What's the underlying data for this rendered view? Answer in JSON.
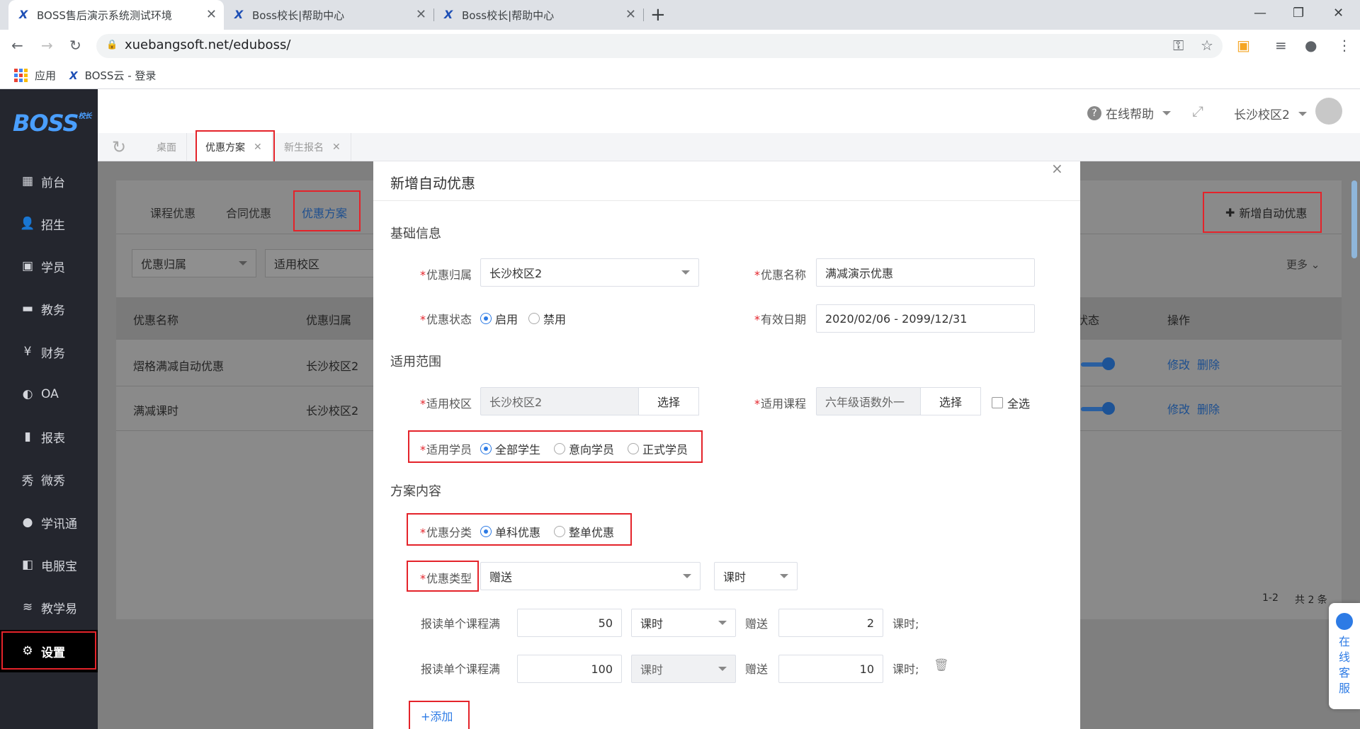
{
  "browser": {
    "tabs": [
      {
        "title": "BOSS售后演示系统测试环境",
        "active": true
      },
      {
        "title": "Boss校长|帮助中心",
        "active": false
      },
      {
        "title": "Boss校长|帮助中心",
        "active": false
      }
    ],
    "url": "xuebangsoft.net/eduboss/",
    "bookmarks": [
      {
        "label": "应用",
        "icon": "apps-grid-icon"
      },
      {
        "label": "BOSS云 - 登录",
        "icon": "boss-favicon"
      }
    ]
  },
  "app": {
    "logo": "BOSS",
    "logo_sub": "校长",
    "menu": [
      {
        "label": "前台",
        "icon": "calendar-icon"
      },
      {
        "label": "招生",
        "icon": "user-add-icon"
      },
      {
        "label": "学员",
        "icon": "id-card-icon"
      },
      {
        "label": "教务",
        "icon": "book-icon"
      },
      {
        "label": "财务",
        "icon": "yen-icon"
      },
      {
        "label": "OA",
        "icon": "chat-icon"
      },
      {
        "label": "报表",
        "icon": "bar-chart-icon"
      },
      {
        "label": "微秀",
        "icon": "weixiu-icon"
      },
      {
        "label": "学讯通",
        "icon": "location-icon"
      },
      {
        "label": "电服宝",
        "icon": "phone-book-icon"
      },
      {
        "label": "教学易",
        "icon": "teach-icon"
      },
      {
        "label": "设置",
        "icon": "gear-icon",
        "active": true
      }
    ],
    "topbar": {
      "help_label": "在线帮助",
      "campus": "长沙校区2"
    },
    "page_tabs": [
      {
        "label": "桌面",
        "closable": false
      },
      {
        "label": "优惠方案",
        "closable": true,
        "active": true
      },
      {
        "label": "新生报名",
        "closable": true
      }
    ],
    "subtabs": [
      "课程优惠",
      "合同优惠",
      "优惠方案"
    ],
    "active_subtab": "优惠方案",
    "add_button": "新增自动优惠",
    "filters": [
      "优惠归属",
      "适用校区"
    ],
    "more_label": "更多",
    "table": {
      "headers": [
        "优惠名称",
        "优惠归属",
        "状态",
        "操作"
      ],
      "rows": [
        {
          "name": "熠格满减自动优惠",
          "owner": "长沙校区2",
          "enabled": true,
          "edit": "修改",
          "delete": "删除"
        },
        {
          "name": "满减课时",
          "owner": "长沙校区2",
          "enabled": true,
          "edit": "修改",
          "delete": "删除"
        }
      ],
      "pagination": "1-2",
      "total": "共 2 条"
    },
    "float_service": "在线客服"
  },
  "modal": {
    "title": "新增自动优惠",
    "close": "×",
    "sections": {
      "basic": "基础信息",
      "scope": "适用范围",
      "content": "方案内容"
    },
    "fields": {
      "owner": {
        "label": "优惠归属",
        "value": "长沙校区2"
      },
      "name": {
        "label": "优惠名称",
        "value": "满减演示优惠"
      },
      "status": {
        "label": "优惠状态",
        "options": [
          "启用",
          "禁用"
        ],
        "selected": "启用"
      },
      "date": {
        "label": "有效日期",
        "value": "2020/02/06 - 2099/12/31"
      },
      "campus": {
        "label": "适用校区",
        "value": "长沙校区2",
        "button": "选择"
      },
      "course": {
        "label": "适用课程",
        "value": "六年级语数外一",
        "button": "选择",
        "select_all": "全选"
      },
      "students": {
        "label": "适用学员",
        "options": [
          "全部学生",
          "意向学员",
          "正式学员"
        ],
        "selected": "全部学生"
      },
      "category": {
        "label": "优惠分类",
        "options": [
          "单科优惠",
          "整单优惠"
        ],
        "selected": "单科优惠"
      },
      "type": {
        "label": "优惠类型",
        "value": "赠送",
        "unit": "课时"
      }
    },
    "rules": [
      {
        "prefix": "报读单个课程满",
        "amount": "50",
        "unit": "课时",
        "gift_label": "赠送",
        "gift": "2",
        "suffix": "课时;"
      },
      {
        "prefix": "报读单个课程满",
        "amount": "100",
        "unit": "课时",
        "gift_label": "赠送",
        "gift": "10",
        "suffix": "课时;"
      }
    ],
    "add_link": "+添加"
  }
}
